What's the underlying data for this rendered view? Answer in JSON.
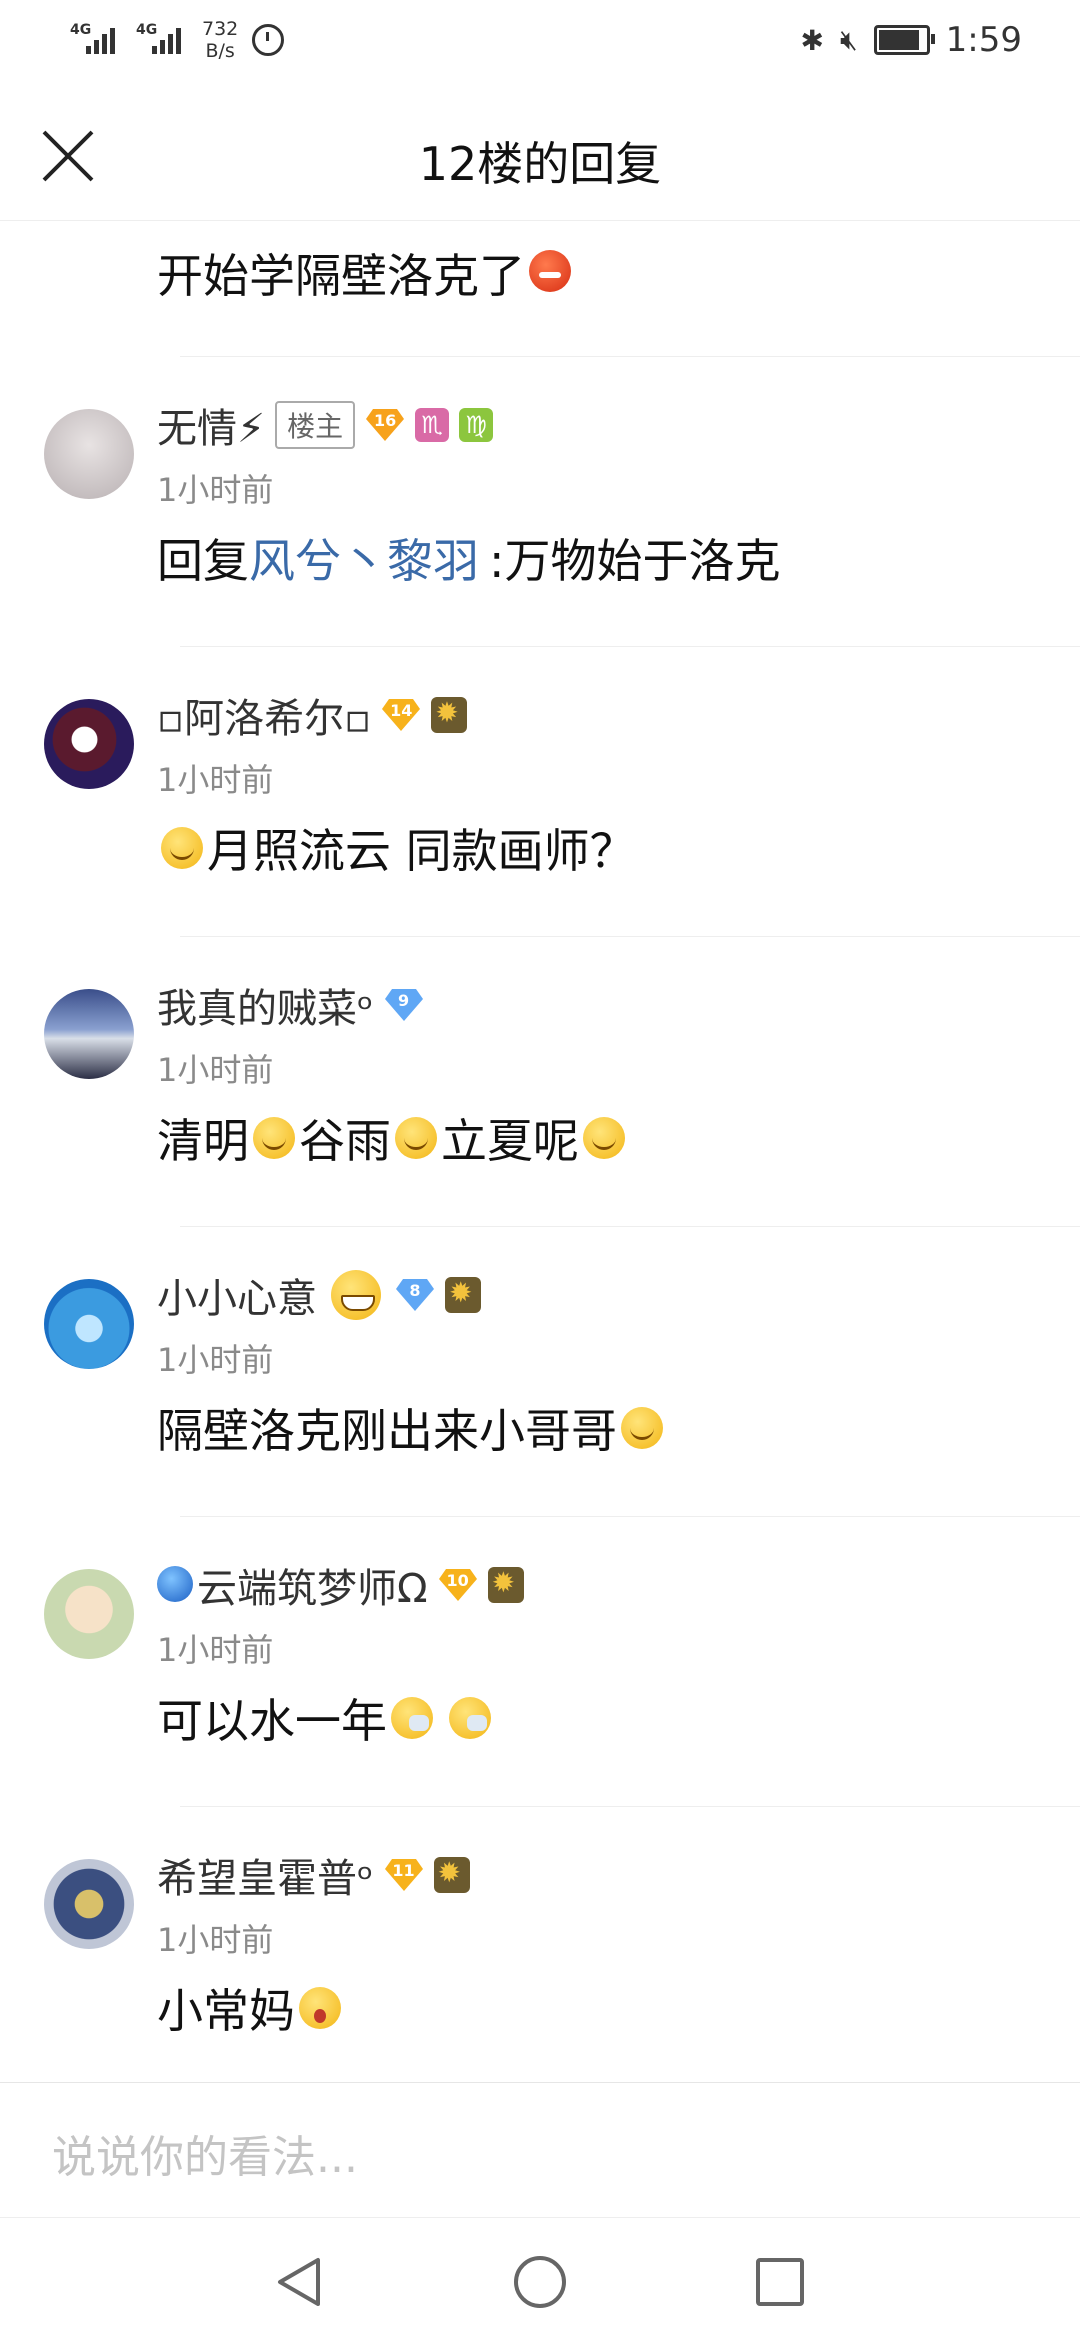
{
  "status_bar": {
    "signal1": "4G",
    "signal2": "4G",
    "speed_value": "732",
    "speed_unit": "B/s",
    "time": "1:59"
  },
  "header": {
    "title": "12楼的回复"
  },
  "first_reply": {
    "text": "开始学隔壁洛克了"
  },
  "comments": [
    {
      "username": "无情⚡",
      "owner_tag": "楼主",
      "level": "16",
      "time": "1小时前",
      "reply_prefix": "回复 ",
      "reply_target": "风兮丶黎羽",
      "content": " :万物始于洛克"
    },
    {
      "username": "▫阿洛希尔▫",
      "level": "14",
      "time": "1小时前",
      "content": "月照流云 同款画师？"
    },
    {
      "username": "我真的贼菜ᵒ",
      "level": "9",
      "time": "1小时前",
      "content_parts": [
        "清明",
        "谷雨",
        "立夏呢"
      ]
    },
    {
      "username": "小小心意",
      "level": "8",
      "time": "1小时前",
      "content": "隔壁洛克刚出来小哥哥"
    },
    {
      "username": "云端筑梦师Ω",
      "level": "10",
      "time": "1小时前",
      "content": "可以水一年"
    },
    {
      "username": "希望皇霍普ᵒ",
      "level": "11",
      "time": "1小时前",
      "content": "小常妈"
    }
  ],
  "input": {
    "placeholder": "说说你的看法..."
  },
  "colors": {
    "link": "#3a6aa8",
    "orange_level": "#f7a21b",
    "blue_level": "#5fa7f5",
    "time_text": "#8a8a8a"
  }
}
